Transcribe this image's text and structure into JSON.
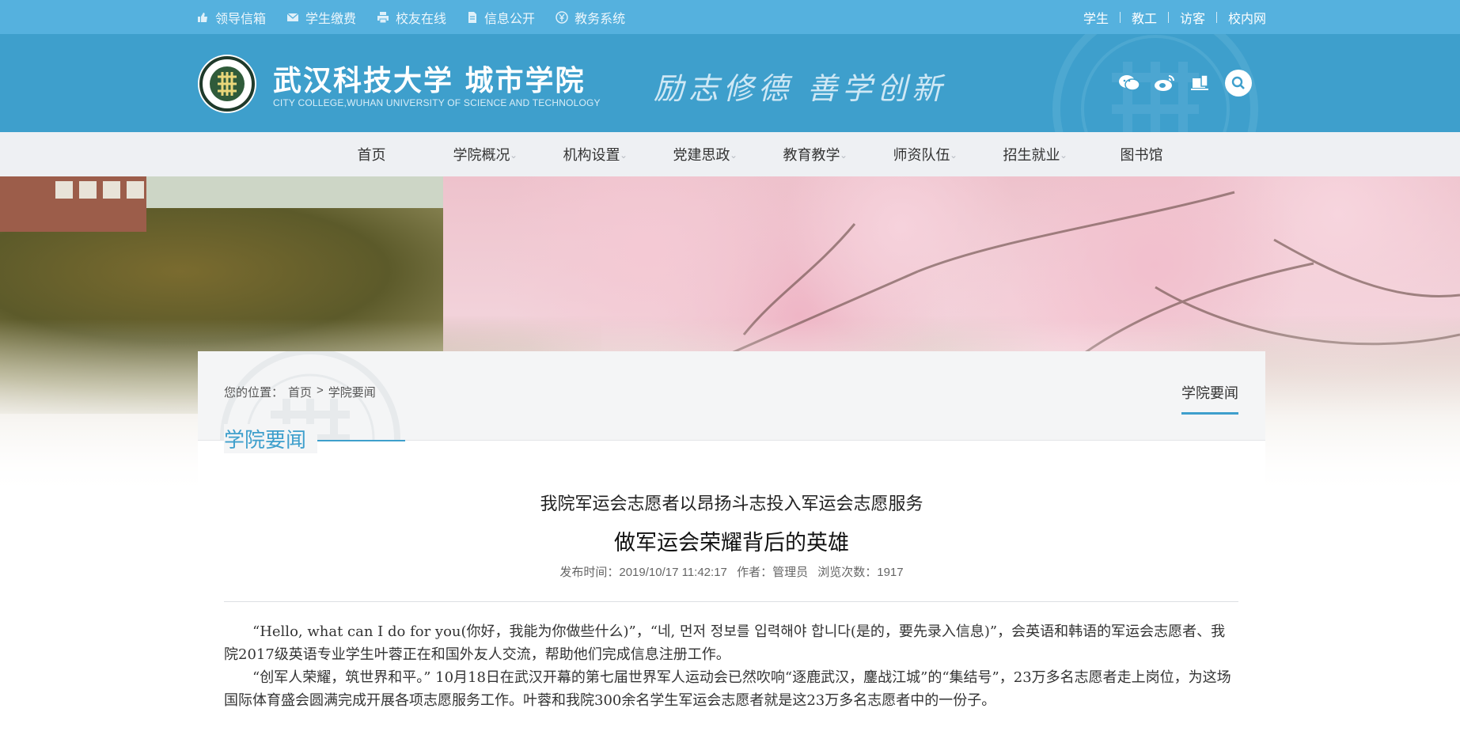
{
  "topbar": {
    "left_items": [
      {
        "label": "领导信箱",
        "icon": "thumb-icon"
      },
      {
        "label": "学生缴费",
        "icon": "mail-icon"
      },
      {
        "label": "校友在线",
        "icon": "printer-icon"
      },
      {
        "label": "信息公开",
        "icon": "document-icon"
      },
      {
        "label": "教务系统",
        "icon": "coin-icon"
      }
    ],
    "right_items": [
      "学生",
      "教工",
      "访客",
      "校内网"
    ]
  },
  "header": {
    "college_name_cn": "武汉科技大学 城市学院",
    "college_name_en": "CITY COLLEGE,WUHAN UNIVERSITY OF SCIENCE AND TECHNOLOGY",
    "motto": "励志修德 善学创新",
    "social_icons": [
      "wechat-icon",
      "weibo-icon",
      "mobile-icon",
      "search-icon"
    ]
  },
  "nav": {
    "items": [
      {
        "label": "首页",
        "has_dropdown": false
      },
      {
        "label": "学院概况",
        "has_dropdown": true
      },
      {
        "label": "机构设置",
        "has_dropdown": true
      },
      {
        "label": "党建思政",
        "has_dropdown": true
      },
      {
        "label": "教育教学",
        "has_dropdown": true
      },
      {
        "label": "师资队伍",
        "has_dropdown": true
      },
      {
        "label": "招生就业",
        "has_dropdown": true
      },
      {
        "label": "图书馆",
        "has_dropdown": false
      }
    ],
    "chevron": "⌄"
  },
  "breadcrumb": {
    "prefix": "您的位置：",
    "home": "首页",
    "separator": ">",
    "current": "学院要闻"
  },
  "side_tab": "学院要闻",
  "section_title": "学院要闻",
  "article": {
    "subtitle": "我院军运会志愿者以昂扬斗志投入军运会志愿服务",
    "title": "做军运会荣耀背后的英雄",
    "meta": {
      "publish_time": "发布时间：2019/10/17 11:42:17",
      "author": "作者：管理员",
      "views": "浏览次数：1917"
    },
    "paragraphs": [
      "“Hello, what can I do for you(你好，我能为你做些什么)”，“네, 먼저 정보를 입력해야 합니다(是的，要先录入信息)”，会英语和韩语的军运会志愿者、我院2017级英语专业学生叶蓉正在和国外友人交流，帮助他们完成信息注册工作。",
      "“创军人荣耀，筑世界和平。” 10月18日在武汉开幕的第七届世界军人运动会已然吹响“逐鹿武汉，鏖战江城”的“集结号”，23万多名志愿者走上岗位，为这场国际体育盛会圆满完成开展各项志愿服务工作。叶蓉和我院300余名学生军运会志愿者就是这23万多名志愿者中的一份子。"
    ]
  },
  "colors": {
    "topbar": "#55b1de",
    "header": "#3e9fcc",
    "nav_bg": "#eef0f3",
    "accent": "#3e9fcc"
  }
}
